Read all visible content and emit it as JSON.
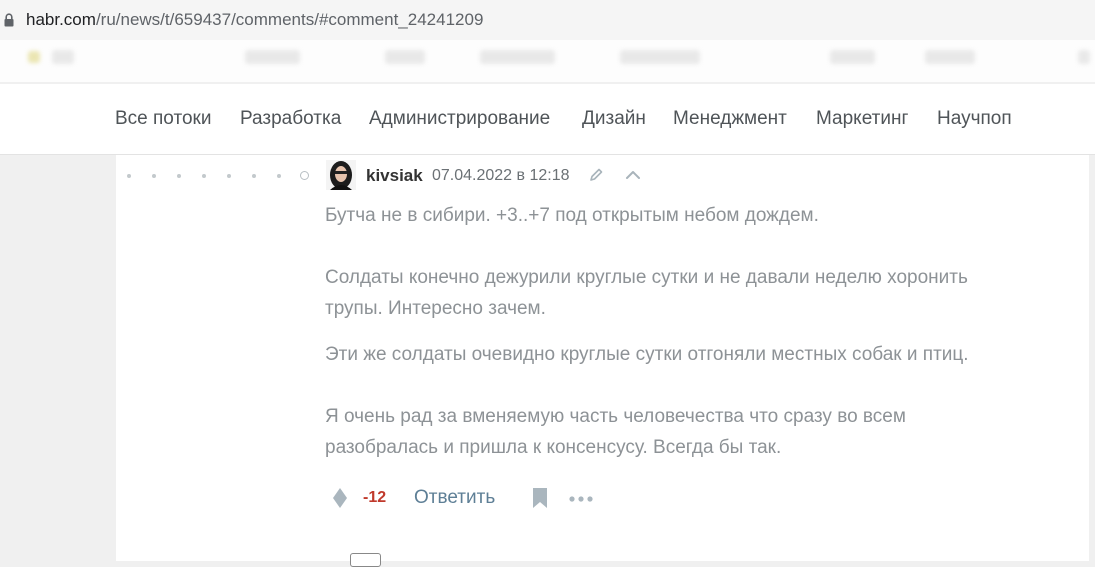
{
  "browser": {
    "url_domain": "habr.com",
    "url_path": "/ru/news/t/659437/comments/#comment_24241209"
  },
  "nav": {
    "items": [
      "Все потоки",
      "Разработка",
      "Администрирование",
      "Дизайн",
      "Менеджмент",
      "Маркетинг",
      "Научпоп"
    ]
  },
  "comment": {
    "username": "kivsiak",
    "timestamp": "07.04.2022 в 12:18",
    "lines": [
      "Бутча не в сибири. +3..+7 под открытым небом дождем.",
      "Солдаты конечно дежурили круглые сутки и не давали неделю хоронить",
      "трупы. Интересно зачем.",
      "Эти же солдаты очевидно круглые сутки отгоняли местных собак и птиц.",
      "Я очень рад за вменяемую часть человечества что сразу во всем",
      "разобралась и пришла к консенсусу. Всегда бы так."
    ],
    "score": "-12",
    "reply_label": "Ответить"
  },
  "colors": {
    "score_negative": "#c0392b",
    "reply_link": "#5e7f96",
    "comment_text": "#8d9296"
  }
}
